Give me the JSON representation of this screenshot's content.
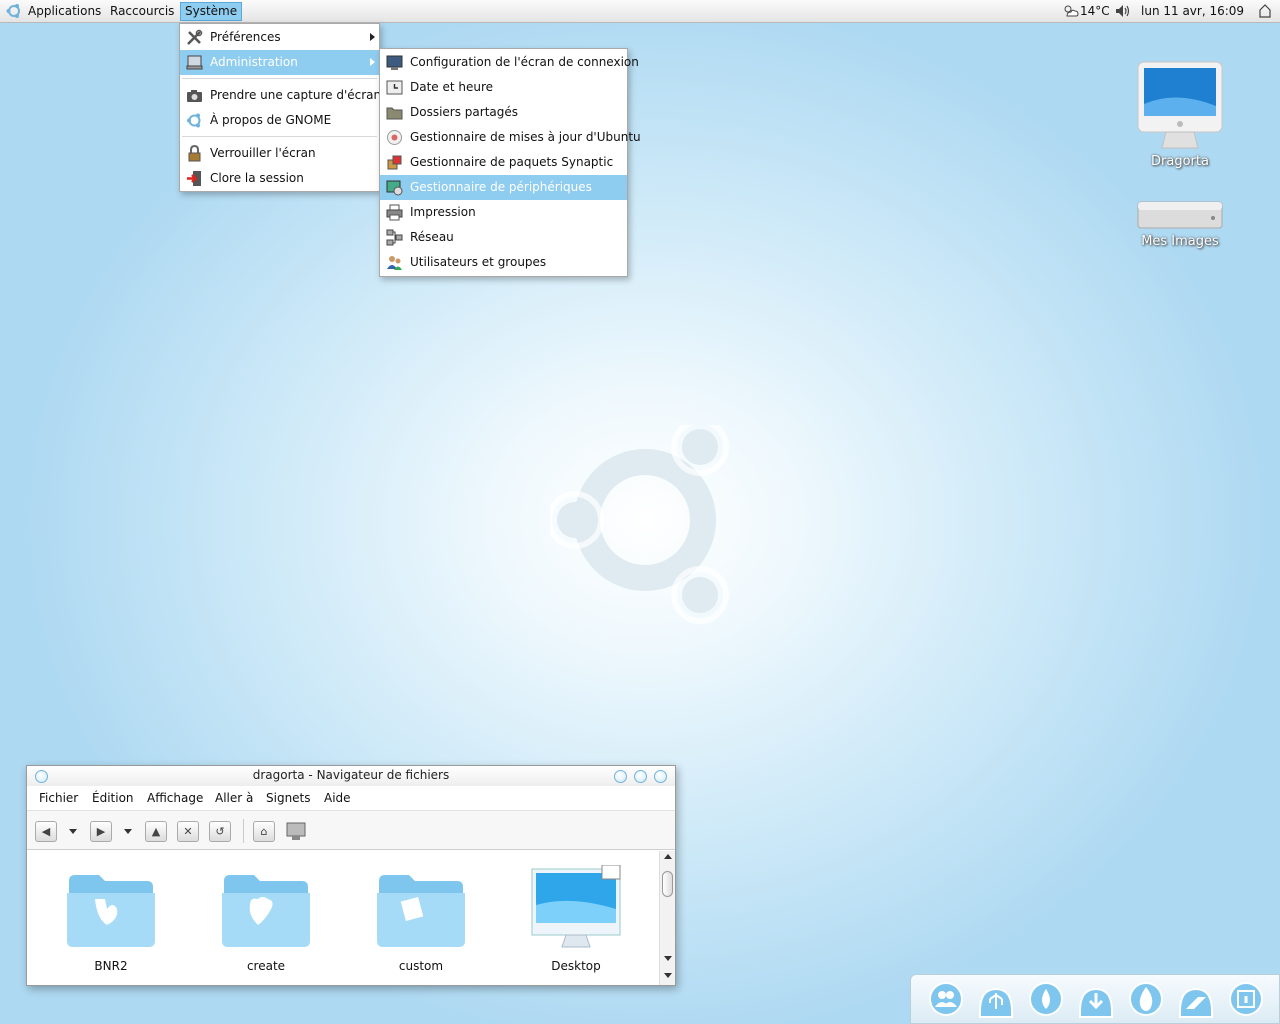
{
  "top_panel": {
    "menus": [
      "Applications",
      "Raccourcis",
      "Système"
    ],
    "weather": "14°C",
    "clock": "lun 11 avr, 16:09"
  },
  "system_menu": {
    "items": [
      {
        "label": "Préférences",
        "icon": "preferences-icon",
        "submenu": true
      },
      {
        "label": "Administration",
        "icon": "administration-icon",
        "submenu": true
      },
      {
        "label": "Prendre une capture d'écran...",
        "icon": "camera-icon"
      },
      {
        "label": "À propos de GNOME",
        "icon": "gnome-icon"
      },
      {
        "label": "Verrouiller l'écran",
        "icon": "lock-icon"
      },
      {
        "label": "Clore la session",
        "icon": "logout-icon"
      }
    ]
  },
  "admin_menu": {
    "items": [
      {
        "label": "Configuration de l'écran de connexion",
        "icon": "login-screen-icon"
      },
      {
        "label": "Date et heure",
        "icon": "clock-icon"
      },
      {
        "label": "Dossiers partagés",
        "icon": "shared-folder-icon"
      },
      {
        "label": "Gestionnaire de mises à jour d'Ubuntu",
        "icon": "update-manager-icon"
      },
      {
        "label": "Gestionnaire de paquets Synaptic",
        "icon": "synaptic-icon"
      },
      {
        "label": "Gestionnaire de périphériques",
        "icon": "device-manager-icon"
      },
      {
        "label": "Impression",
        "icon": "printer-icon"
      },
      {
        "label": "Réseau",
        "icon": "network-icon"
      },
      {
        "label": "Utilisateurs et groupes",
        "icon": "users-icon"
      }
    ]
  },
  "desktop_icons": [
    {
      "label": "Dragorta",
      "icon": "computer-icon"
    },
    {
      "label": "Mes Images",
      "icon": "drive-icon"
    }
  ],
  "file_window": {
    "title": "dragorta - Navigateur de fichiers",
    "menus": [
      "Fichier",
      "Édition",
      "Affichage",
      "Aller à",
      "Signets",
      "Aide"
    ],
    "files": [
      "BNR2",
      "create",
      "custom",
      "Desktop"
    ]
  },
  "dock": {
    "items": [
      "users-icon",
      "usb-icon",
      "ink-icon",
      "download-icon",
      "flame-icon",
      "installer-icon",
      "info-icon"
    ]
  }
}
